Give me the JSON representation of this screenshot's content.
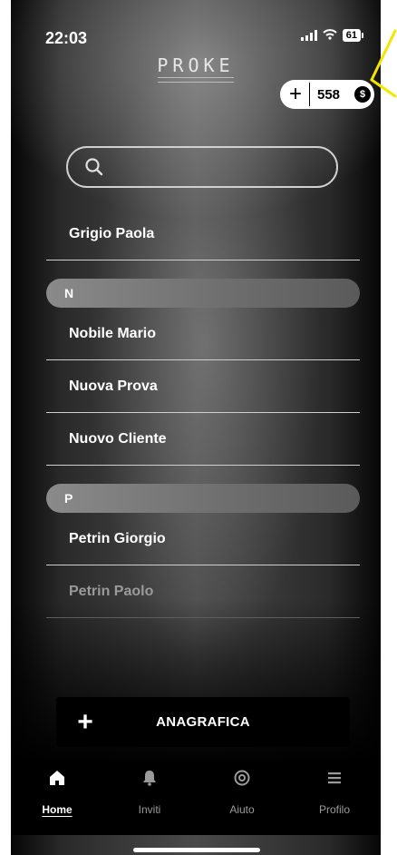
{
  "status_bar": {
    "time": "22:03",
    "battery": "61"
  },
  "header": {
    "logo": "PROKE",
    "credits": {
      "plus": "+",
      "value": "558",
      "coin_symbol": "$"
    }
  },
  "search": {
    "placeholder": ""
  },
  "contacts": {
    "first": "Grigio Paola",
    "section_n": "N",
    "n_items": [
      "Nobile Mario",
      "Nuova Prova",
      "Nuovo Cliente"
    ],
    "section_p": "P",
    "p_items": [
      "Petrin Giorgio",
      "Petrin Paolo"
    ]
  },
  "cta": {
    "plus": "+",
    "label": "ANAGRAFICA"
  },
  "tabs": [
    {
      "label": "Home",
      "icon": "home-icon",
      "active": true
    },
    {
      "label": "Inviti",
      "icon": "bell-icon",
      "active": false
    },
    {
      "label": "Aiuto",
      "icon": "lifebuoy-icon",
      "active": false
    },
    {
      "label": "Profilo",
      "icon": "menu-icon",
      "active": false
    }
  ],
  "colors": {
    "background": "#3a3a3a",
    "accent": "#ffffff",
    "cta": "#000000"
  }
}
